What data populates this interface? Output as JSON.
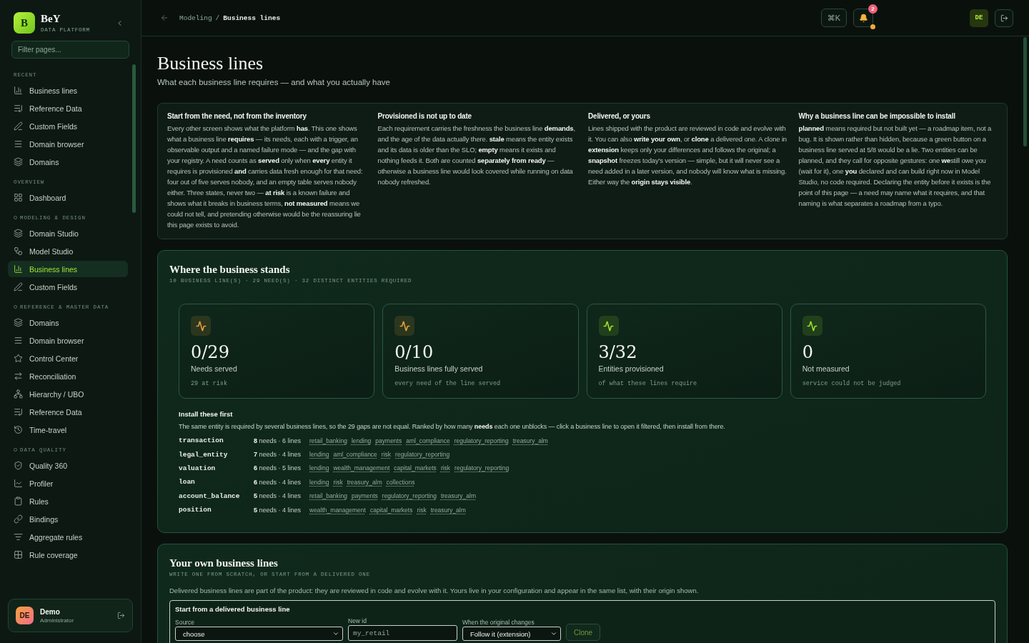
{
  "sidebar": {
    "brand": {
      "logo_letter": "B",
      "name": "BeY",
      "tagline": "DATA PLATFORM"
    },
    "filter": {
      "placeholder": "Filter pages..."
    },
    "sections": [
      {
        "title": "RECENT",
        "marker": false,
        "items": [
          {
            "label": "Business lines",
            "kind": "chart",
            "selected": false
          },
          {
            "label": "Reference Data",
            "kind": "list",
            "selected": false
          },
          {
            "label": "Custom Fields",
            "kind": "pencil",
            "selected": false
          },
          {
            "label": "Domain browser",
            "kind": "menu",
            "selected": false
          },
          {
            "label": "Domains",
            "kind": "layers",
            "selected": false
          }
        ]
      },
      {
        "title": "OVERVIEW",
        "marker": false,
        "items": [
          {
            "label": "Dashboard",
            "kind": "grid",
            "selected": false
          }
        ]
      },
      {
        "title": "MODELING & DESIGN",
        "marker": true,
        "items": [
          {
            "label": "Domain Studio",
            "kind": "layers",
            "selected": false
          },
          {
            "label": "Model Studio",
            "kind": "flow",
            "selected": false
          },
          {
            "label": "Business lines",
            "kind": "chart",
            "selected": true
          },
          {
            "label": "Custom Fields",
            "kind": "pencil",
            "selected": false
          }
        ]
      },
      {
        "title": "REFERENCE & MASTER DATA",
        "marker": true,
        "items": [
          {
            "label": "Domains",
            "kind": "layers",
            "selected": false
          },
          {
            "label": "Domain browser",
            "kind": "menu",
            "selected": false
          },
          {
            "label": "Control Center",
            "kind": "star",
            "selected": false
          },
          {
            "label": "Reconciliation",
            "kind": "swap",
            "selected": false
          },
          {
            "label": "Hierarchy / UBO",
            "kind": "tree",
            "selected": false
          },
          {
            "label": "Reference Data",
            "kind": "list",
            "selected": false
          },
          {
            "label": "Time-travel",
            "kind": "history",
            "selected": false
          }
        ]
      },
      {
        "title": "DATA QUALITY",
        "marker": true,
        "items": [
          {
            "label": "Quality 360",
            "kind": "shield",
            "selected": false
          },
          {
            "label": "Profiler",
            "kind": "trend",
            "selected": false
          },
          {
            "label": "Rules",
            "kind": "clipboard",
            "selected": false
          },
          {
            "label": "Bindings",
            "kind": "link",
            "selected": false
          },
          {
            "label": "Aggregate rules",
            "kind": "filter",
            "selected": false
          },
          {
            "label": "Rule coverage",
            "kind": "blocks",
            "selected": false
          }
        ]
      }
    ],
    "user": {
      "initials": "DE",
      "name": "Demo",
      "role": "Administrator"
    }
  },
  "topbar": {
    "breadcrumb": {
      "parent": "Modeling",
      "separator": "/",
      "current": "Business lines"
    },
    "command_shortcut": "⌘K",
    "notifications": {
      "count": "2",
      "alert": true
    },
    "user_initials": "DE"
  },
  "header": {
    "title": "Business lines",
    "subtitle": "What each business line requires — and what you actually have"
  },
  "explainers": [
    {
      "title": "Start from the need, not from the inventory",
      "body": "Every other screen shows what the platform **has**. This one shows what a business line **requires** — its needs, each with a trigger, an observable output and a named failure mode — and the gap with your registry. A need counts as **served** only when **every** entity it requires is provisioned **and** carries data fresh enough for that need: four out of five serves nobody, and an empty table serves nobody either. Three states, never two — **at risk** is a known failure and shows what it breaks in business terms, **not measured** means we could not tell, and pretending otherwise would be the reassuring lie this page exists to avoid."
    },
    {
      "title": "Provisioned is not up to date",
      "body": "Each requirement carries the freshness the business line **demands**, and the age of the data actually there. **stale** means the entity exists and its data is older than the SLO; **empty** means it exists and nothing feeds it. Both are counted **separately from ready** — otherwise a business line would look covered while running on data nobody refreshed."
    },
    {
      "title": "Delivered, or yours",
      "body": "Lines shipped with the product are reviewed in code and evolve with it. You can also **write your own**, or **clone** a delivered one. A clone in **extension** keeps only your differences and follows the original; a **snapshot** freezes today's version — simple, but it will never see a need added in a later version, and nobody will know what is missing. Either way the **origin stays visible**."
    },
    {
      "title": "Why a business line can be impossible to install",
      "body": "**planned** means required but not built yet — a roadmap item, not a bug. It is shown rather than hidden, because a green button on a business line served at 5/8 would be a lie. Two entities can be planned, and they call for opposite gestures: one **we**still owe you (wait for it), one **you** declared and can build right now in Model Studio, no code required. Declaring the entity before it exists is the point of this page — a need may name what it requires, and that naming is what separates a roadmap from a typo."
    }
  ],
  "overview": {
    "title": "Where the business stands",
    "summary": "10 BUSINESS LINE(S) · 29 NEED(S) · 32 DISTINCT ENTITIES REQUIRED",
    "stats": [
      {
        "value": "0/29",
        "label": "Needs served",
        "note": "29 at risk",
        "color": "#e2a23a"
      },
      {
        "value": "0/10",
        "label": "Business lines fully served",
        "note": "every need of the line served",
        "color": "#e2a23a"
      },
      {
        "value": "3/32",
        "label": "Entities provisioned",
        "note": "of what these lines require",
        "color": "#9ee02e"
      },
      {
        "value": "0",
        "label": "Not measured",
        "note": "service could not be judged",
        "color": "#9ee02e"
      }
    ],
    "install": {
      "title": "Install these first",
      "description": "The same entity is required by several business lines, so the 29 gaps are not equal. Ranked by how many **needs** each one unblocks — click a business line to open it filtered, then install from there.",
      "rows": [
        {
          "entity": "transaction",
          "needs": "**8** needs · 6 lines",
          "lines": [
            "retail_banking",
            "lending",
            "payments",
            "aml_compliance",
            "regulatory_reporting",
            "treasury_alm"
          ]
        },
        {
          "entity": "legal_entity",
          "needs": "**7** needs · 4 lines",
          "lines": [
            "lending",
            "aml_compliance",
            "risk",
            "regulatory_reporting"
          ]
        },
        {
          "entity": "valuation",
          "needs": "**6** needs · 5 lines",
          "lines": [
            "lending",
            "wealth_management",
            "capital_markets",
            "risk",
            "regulatory_reporting"
          ]
        },
        {
          "entity": "loan",
          "needs": "**6** needs · 4 lines",
          "lines": [
            "lending",
            "risk",
            "treasury_alm",
            "collections"
          ]
        },
        {
          "entity": "account_balance",
          "needs": "**5** needs · 4 lines",
          "lines": [
            "retail_banking",
            "payments",
            "regulatory_reporting",
            "treasury_alm"
          ]
        },
        {
          "entity": "position",
          "needs": "**5** needs · 4 lines",
          "lines": [
            "wealth_management",
            "capital_markets",
            "risk",
            "treasury_alm"
          ]
        }
      ]
    }
  },
  "own": {
    "title": "Your own business lines",
    "subtitle": "WRITE ONE FROM SCRATCH, OR START FROM A DELIVERED ONE",
    "description": "Delivered business lines are part of the product: they are reviewed in code and evolve with it. Yours live in your configuration and appear in the same list, with their origin shown.",
    "clone_form": {
      "title": "Start from a delivered business line",
      "fields": [
        {
          "kind": "select",
          "label": "Source",
          "value": "choose"
        },
        {
          "kind": "text",
          "label": "New id",
          "placeholder": "my_retail"
        },
        {
          "kind": "select",
          "label": "When the original changes",
          "value": "Follow it (extension)"
        }
      ],
      "button": {
        "label": "Clone",
        "disabled": true
      }
    }
  }
}
